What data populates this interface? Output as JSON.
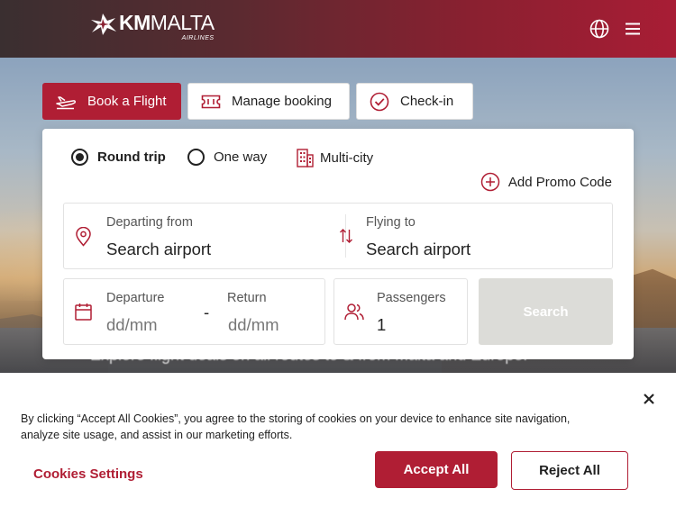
{
  "header": {
    "logo_main": "KM",
    "logo_main_rest": "MALTA",
    "logo_sub": "AIRLINES",
    "icons": [
      "globe-icon",
      "menu-icon"
    ]
  },
  "hero": {
    "tagline": "Explore flight deals on all routes to & from Malta and Europe."
  },
  "tabs": [
    {
      "label": "Book a Flight",
      "icon": "plane-icon",
      "active": true
    },
    {
      "label": "Manage booking",
      "icon": "ticket-icon",
      "active": false
    },
    {
      "label": "Check-in",
      "icon": "check-circle-icon",
      "active": false
    }
  ],
  "trip_types": [
    {
      "label": "Round trip",
      "selected": true
    },
    {
      "label": "One way",
      "selected": false
    },
    {
      "label": "Multi-city",
      "selected": false
    }
  ],
  "promo": {
    "label": "Add Promo Code"
  },
  "route": {
    "from_label": "Departing from",
    "from_placeholder": "Search airport",
    "to_label": "Flying to",
    "to_placeholder": "Search airport"
  },
  "dates": {
    "departure_label": "Departure",
    "departure_placeholder": "dd/mm",
    "separator": "-",
    "return_label": "Return",
    "return_placeholder": "dd/mm"
  },
  "passengers": {
    "label": "Passengers",
    "value": "1"
  },
  "search_button": {
    "label": "Search"
  },
  "cookie_banner": {
    "text": "By clicking “Accept All Cookies”, you agree to the storing of cookies on your device to enhance site navigation, analyze site usage, and assist in our marketing efforts.",
    "settings_label": "Cookies Settings",
    "accept_label": "Accept All",
    "reject_label": "Reject All"
  },
  "colors": {
    "brand": "#b01e34",
    "header_dark": "#3a2f30",
    "search_disabled": "#dcdcd8"
  }
}
